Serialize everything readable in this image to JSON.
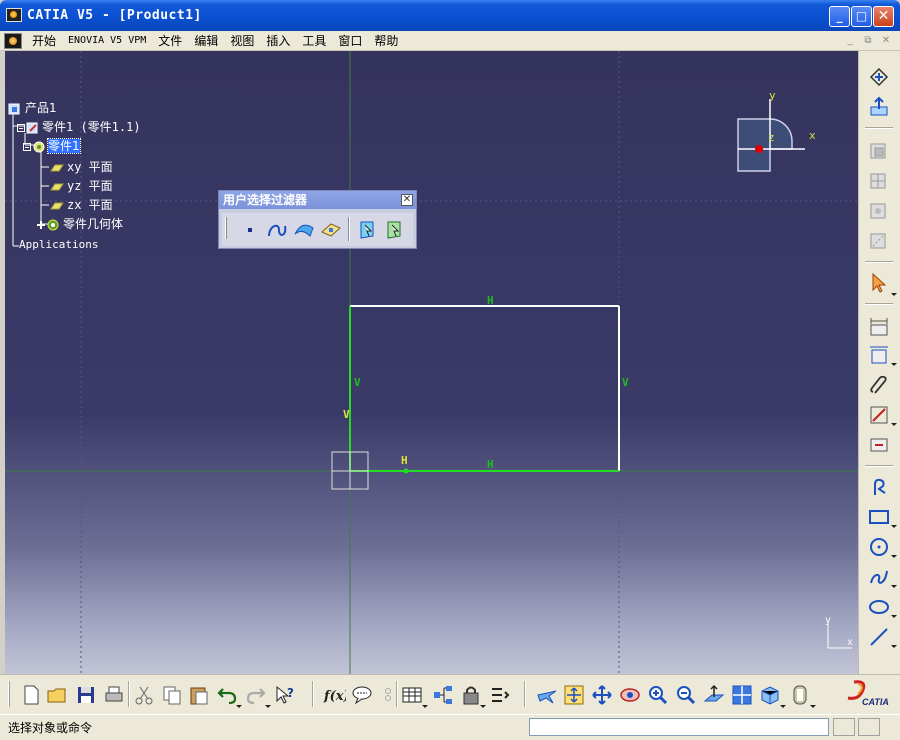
{
  "window": {
    "title": "CATIA V5 - [Product1]",
    "minimize_glyph": "_",
    "maximize_glyph": "□",
    "close_glyph": "✕"
  },
  "menu": {
    "items": [
      "开始",
      "ENOVIA V5 VPM",
      "文件",
      "编辑",
      "视图",
      "插入",
      "工具",
      "窗口",
      "帮助"
    ],
    "mdi_glyphs": [
      "_",
      "⧉",
      "✕"
    ]
  },
  "tree": {
    "product": "产品1",
    "part_instance": "零件1 (零件1.1)",
    "part": "零件1",
    "planes": [
      "xy 平面",
      "yz 平面",
      "zx 平面"
    ],
    "geometry_set": "零件几何体",
    "applications": "Applications"
  },
  "filter_toolbar": {
    "title": "用户选择过滤器",
    "close_glyph": "✕"
  },
  "sketch": {
    "constraint_labels": {
      "top": "H",
      "left": "V",
      "right": "V",
      "bottom": "H",
      "bottom_origin": "H",
      "left_origin": "V"
    }
  },
  "compass": {
    "x_label": "x",
    "y_label": "y",
    "z_label": "z"
  },
  "mini_axis": {
    "x_label": "x",
    "y_label": "y"
  },
  "status": {
    "prompt": "选择对象或命令",
    "command_value": ""
  },
  "logo": {
    "text": "CATIA"
  },
  "colors": {
    "viewport_top": "#35345e",
    "viewport_bottom": "#c2c4d7",
    "sketch_white": "#ffffff",
    "sketch_green": "#22dd22",
    "constraint_green": "#22bb22",
    "origin_yellow": "#e0e040",
    "selection_blue": "#3070ff"
  }
}
